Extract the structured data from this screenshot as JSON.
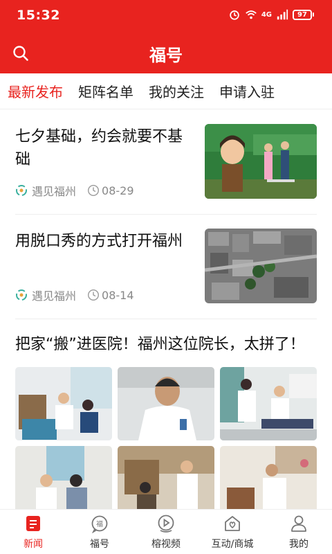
{
  "status_bar": {
    "time": "15:32",
    "network": "4G",
    "battery": "97"
  },
  "header": {
    "title": "福号"
  },
  "tabs": [
    {
      "label": "最新发布",
      "active": true
    },
    {
      "label": "矩阵名单",
      "active": false
    },
    {
      "label": "我的关注",
      "active": false
    },
    {
      "label": "申请入驻",
      "active": false
    }
  ],
  "feed": [
    {
      "title": "七夕基础，约会就要不基础",
      "source": "遇见福州",
      "date": "08-29",
      "image": "event-stage-photo"
    },
    {
      "title": "用脱口秀的方式打开福州",
      "source": "遇见福州",
      "date": "08-14",
      "image": "aerial-city-photo"
    },
    {
      "title": "把家“搬”进医院！福州这位院长，太拼了！"
    }
  ],
  "bottom_nav": [
    {
      "label": "新闻",
      "icon": "news-icon",
      "active": true
    },
    {
      "label": "福号",
      "icon": "fuhao-icon",
      "active": false
    },
    {
      "label": "榕视频",
      "icon": "video-icon",
      "active": false
    },
    {
      "label": "互动/商城",
      "icon": "shop-icon",
      "active": false
    },
    {
      "label": "我的",
      "icon": "profile-icon",
      "active": false
    }
  ],
  "colors": {
    "brand": "#e8231f",
    "meta_text": "#888888"
  }
}
